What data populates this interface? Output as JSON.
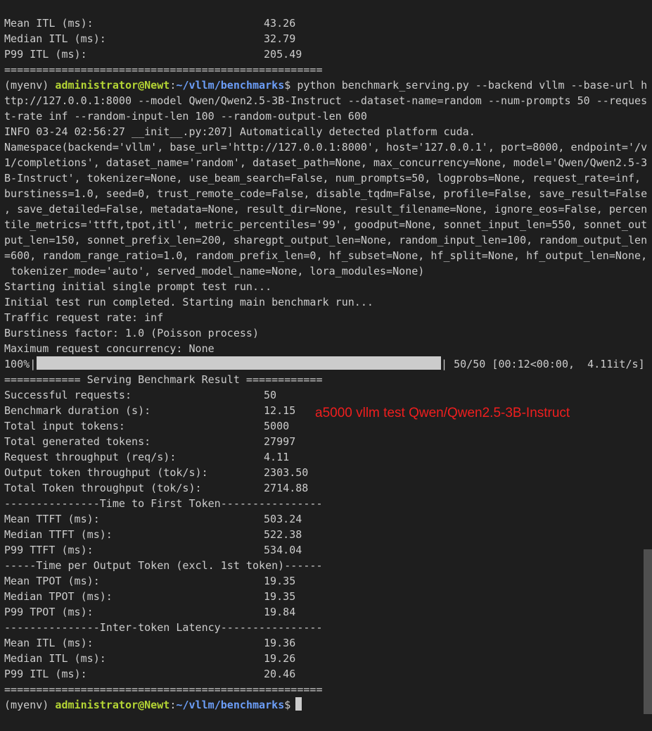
{
  "terminal": {
    "top_stats": [
      {
        "label": "Mean ITL (ms):",
        "value": "43.26"
      },
      {
        "label": "Median ITL (ms):",
        "value": "32.79"
      },
      {
        "label": "P99 ITL (ms):",
        "value": "205.49"
      }
    ],
    "separator": "==================================================",
    "prompt": {
      "env": "(myenv) ",
      "user": "administrator@Newt",
      "colon": ":",
      "path": "~/vllm/benchmarks",
      "dollar": "$"
    },
    "command_lines": [
      " python benchmark_serving.py --backend vllm --base-url h",
      "ttp://127.0.0.1:8000 --model Qwen/Qwen2.5-3B-Instruct --dataset-name=random --num-prompts 50 --reques",
      "t-rate inf --random-input-len 100 --random-output-len 600"
    ],
    "output_lines": [
      "INFO 03-24 02:56:27 __init__.py:207] Automatically detected platform cuda.",
      "Namespace(backend='vllm', base_url='http://127.0.0.1:8000', host='127.0.0.1', port=8000, endpoint='/v",
      "1/completions', dataset_name='random', dataset_path=None, max_concurrency=None, model='Qwen/Qwen2.5-3",
      "B-Instruct', tokenizer=None, use_beam_search=False, num_prompts=50, logprobs=None, request_rate=inf,",
      "burstiness=1.0, seed=0, trust_remote_code=False, disable_tqdm=False, profile=False, save_result=False",
      ", save_detailed=False, metadata=None, result_dir=None, result_filename=None, ignore_eos=False, percen",
      "tile_metrics='ttft,tpot,itl', metric_percentiles='99', goodput=None, sonnet_input_len=550, sonnet_out",
      "put_len=150, sonnet_prefix_len=200, sharegpt_output_len=None, random_input_len=100, random_output_len",
      "=600, random_range_ratio=1.0, random_prefix_len=0, hf_subset=None, hf_split=None, hf_output_len=None,",
      " tokenizer_mode='auto', served_model_name=None, lora_modules=None)",
      "Starting initial single prompt test run...",
      "Initial test run completed. Starting main benchmark run...",
      "Traffic request rate: inf",
      "Burstiness factor: 1.0 (Poisson process)",
      "Maximum request concurrency: None"
    ],
    "progress": {
      "percent_label": "100%|",
      "fraction": 1.0,
      "suffix": "| 50/50 [00:12<00:00,  4.11it/s]"
    },
    "result_header": "============ Serving Benchmark Result ============",
    "results": [
      {
        "label": "Successful requests:",
        "value": "50"
      },
      {
        "label": "Benchmark duration (s):",
        "value": "12.15"
      },
      {
        "label": "Total input tokens:",
        "value": "5000"
      },
      {
        "label": "Total generated tokens:",
        "value": "27997"
      },
      {
        "label": "Request throughput (req/s):",
        "value": "4.11"
      },
      {
        "label": "Output token throughput (tok/s):",
        "value": "2303.50"
      },
      {
        "label": "Total Token throughput (tok/s):",
        "value": "2714.88"
      }
    ],
    "ttft_header": "---------------Time to First Token----------------",
    "ttft": [
      {
        "label": "Mean TTFT (ms):",
        "value": "503.24"
      },
      {
        "label": "Median TTFT (ms):",
        "value": "522.38"
      },
      {
        "label": "P99 TTFT (ms):",
        "value": "534.04"
      }
    ],
    "tpot_header": "-----Time per Output Token (excl. 1st token)------",
    "tpot": [
      {
        "label": "Mean TPOT (ms):",
        "value": "19.35"
      },
      {
        "label": "Median TPOT (ms):",
        "value": "19.35"
      },
      {
        "label": "P99 TPOT (ms):",
        "value": "19.84"
      }
    ],
    "itl_header": "---------------Inter-token Latency----------------",
    "itl": [
      {
        "label": "Mean ITL (ms):",
        "value": "19.36"
      },
      {
        "label": "Median ITL (ms):",
        "value": "19.26"
      },
      {
        "label": "P99 ITL (ms):",
        "value": "20.46"
      }
    ],
    "final_prompt_suffix": " "
  },
  "annotation": "a5000 vllm test Qwen/Qwen2.5-3B-Instruct",
  "colors": {
    "background": "#1e1e1e",
    "text": "#cccccc",
    "user": "#b5d634",
    "path": "#6c9ef8",
    "annotation": "#f01e1e"
  }
}
